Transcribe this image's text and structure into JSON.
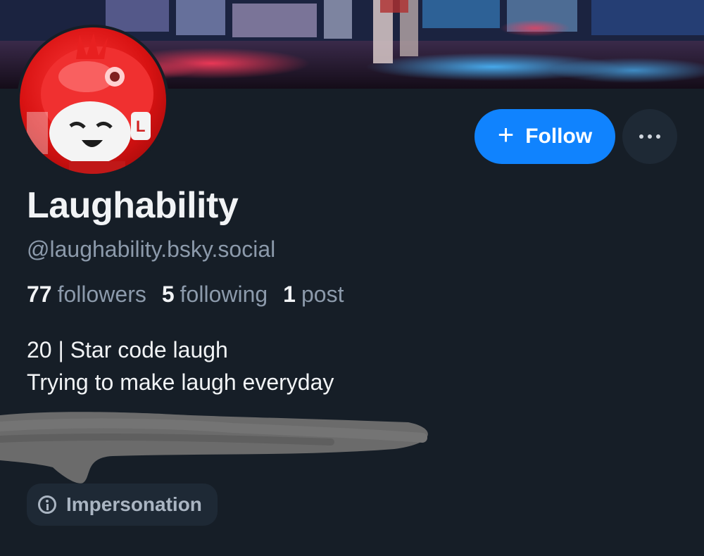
{
  "profile": {
    "display_name": "Laughability",
    "handle": "@laughability.bsky.social",
    "stats": {
      "followers_count": "77",
      "followers_label": "followers",
      "following_count": "5",
      "following_label": "following",
      "posts_count": "1",
      "posts_label": "post"
    },
    "bio_line1": "20 | Star code laugh",
    "bio_line2": "Trying to make laugh everyday"
  },
  "actions": {
    "follow_icon": "+",
    "follow_label": "Follow",
    "more_icon": "ellipsis-icon"
  },
  "labels": [
    {
      "icon": "info-icon",
      "text": "Impersonation"
    }
  ],
  "colors": {
    "background": "#161e27",
    "accent": "#1083fe",
    "muted_text": "#8c9aab",
    "pill_background": "#1e2935"
  }
}
